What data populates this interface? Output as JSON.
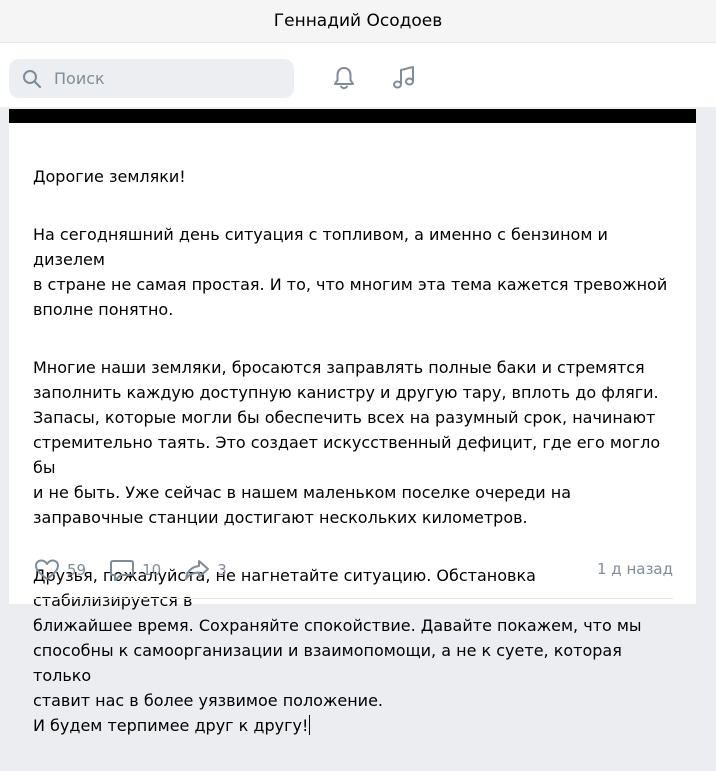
{
  "window": {
    "title": "Геннадий Осодоев"
  },
  "search": {
    "placeholder": "Поиск"
  },
  "toolbar": {
    "notifications_icon": "bell-icon",
    "music_icon": "music-note-icon"
  },
  "post": {
    "paragraphs": [
      "Дорогие земляки!",
      "На сегодняшний день ситуация с топливом, а именно с бензином и дизелем\nв стране не самая простая. И то, что многим эта тема кажется тревожной\nвполне понятно.",
      "Многие наши земляки, бросаются заправлять полные баки и стремятся\nзаполнить каждую доступную канистру и другую тару, вплоть до фляги.\nЗапасы, которые могли бы обеспечить всех на разумный срок, начинают\nстремительно таять. Это создает искусственный дефицит, где его могло бы\nи не быть. Уже сейчас в нашем маленьком поселке очереди на\nзаправочные станции достигают нескольких километров.",
      "Друзья, пожалуйста, не нагнетайте ситуацию. Обстановка стабилизируется в\nближайшее время. Сохраняйте спокойствие. Давайте покажем, что мы\nспособны к самоорганизации и взаимопомощи, а не к суете, которая только\nставит нас в более уязвимое положение.\nИ будем терпимее друг к другу!"
    ],
    "likes": "59",
    "comments": "10",
    "shares": "3",
    "time": "1 д назад"
  },
  "colors": {
    "muted": "#818c99",
    "background": "#ebedf0",
    "search_bg": "#eceef1"
  }
}
